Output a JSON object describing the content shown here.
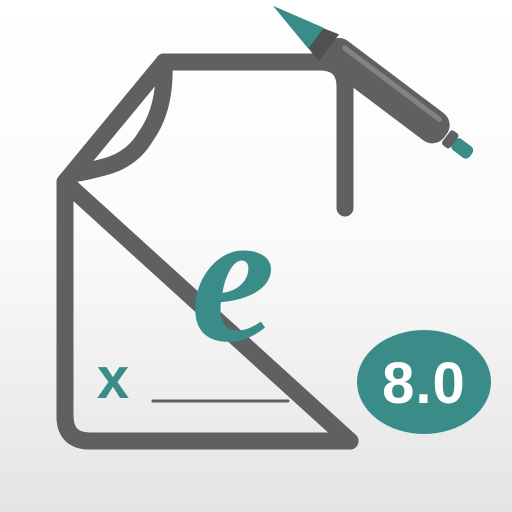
{
  "icon": {
    "logo_letter": "e",
    "signature_mark": "x",
    "version_label": "8.0"
  },
  "colors": {
    "outline": "#5f6062",
    "accent": "#3a8c89",
    "pen_body": "#5f6062",
    "badge_text": "#ffffff",
    "background_top": "#ffffff",
    "background_bottom": "#e4e4e4"
  },
  "icons": {
    "document": "document-outline-icon",
    "pen": "pen-icon",
    "version_badge": "version-badge"
  }
}
